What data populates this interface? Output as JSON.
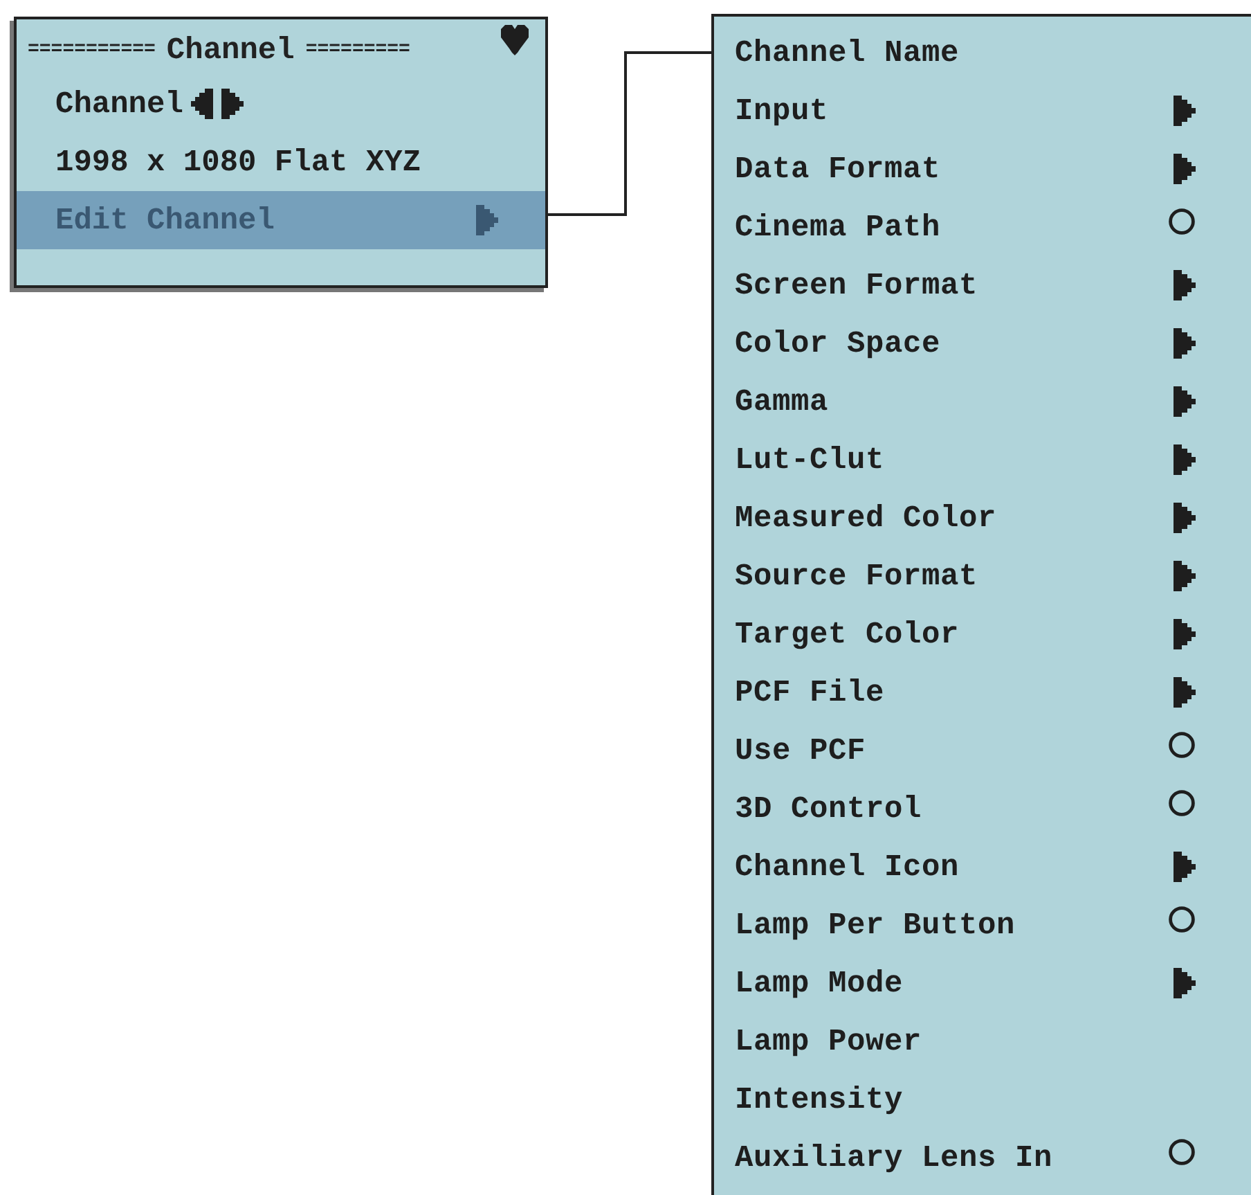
{
  "channel_panel": {
    "title": {
      "left_rule": "===========",
      "text": "Channel",
      "right_rule": "========="
    },
    "rows": [
      {
        "kind": "stepper",
        "label": "Channel",
        "selected": false
      },
      {
        "kind": "value",
        "label": "1998 x 1080 Flat XYZ",
        "selected": false
      },
      {
        "kind": "submenu",
        "label": "Edit Channel",
        "selected": true
      }
    ]
  },
  "edit_menu": {
    "items": [
      {
        "kind": "plain",
        "label": "Channel Name"
      },
      {
        "kind": "submenu",
        "label": "Input"
      },
      {
        "kind": "submenu",
        "label": "Data Format"
      },
      {
        "kind": "option",
        "label": "Cinema Path"
      },
      {
        "kind": "submenu",
        "label": "Screen Format"
      },
      {
        "kind": "submenu",
        "label": "Color Space"
      },
      {
        "kind": "submenu",
        "label": "Gamma"
      },
      {
        "kind": "submenu",
        "label": "Lut-Clut"
      },
      {
        "kind": "submenu",
        "label": "Measured Color"
      },
      {
        "kind": "submenu",
        "label": "Source Format"
      },
      {
        "kind": "submenu",
        "label": "Target Color"
      },
      {
        "kind": "submenu",
        "label": "PCF File"
      },
      {
        "kind": "option",
        "label": "Use PCF"
      },
      {
        "kind": "option",
        "label": "3D Control"
      },
      {
        "kind": "submenu",
        "label": "Channel Icon"
      },
      {
        "kind": "option",
        "label": "Lamp Per Button"
      },
      {
        "kind": "submenu",
        "label": "Lamp Mode"
      },
      {
        "kind": "plain",
        "label": "Lamp Power"
      },
      {
        "kind": "plain",
        "label": "Intensity"
      },
      {
        "kind": "option",
        "label": "Auxiliary Lens In"
      }
    ]
  }
}
